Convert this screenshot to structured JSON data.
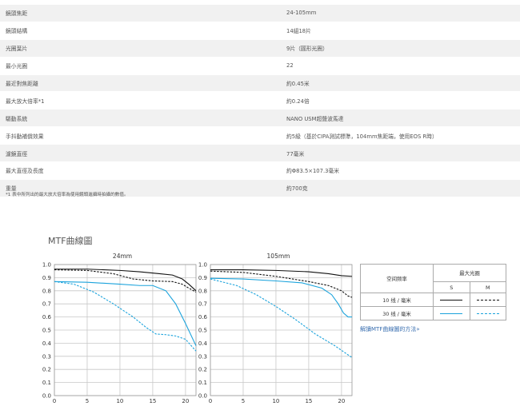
{
  "specs": [
    {
      "label": "鏡頭焦距",
      "value": "24-105mm"
    },
    {
      "label": "鏡頭結構",
      "value": "14組18片"
    },
    {
      "label": "光圈葉片",
      "value": "9片（圓形光圈）"
    },
    {
      "label": "最小光圈",
      "value": "22"
    },
    {
      "label": "最近對焦距離",
      "value": "約0.45米"
    },
    {
      "label": "最大放大倍率*1",
      "value": "約0.24倍"
    },
    {
      "label": "驅動系統",
      "value": "NANO USM超聲波馬達"
    },
    {
      "label": "手抖動補償效果",
      "value": "約5級（基於CIPA測試標準，104mm焦距端，使用EOS R時）"
    },
    {
      "label": "濾鏡直徑",
      "value": "77毫米"
    },
    {
      "label": "最大直徑及長度",
      "value": "約Φ83.5×107.3毫米"
    },
    {
      "label": "重量",
      "value": "約700克"
    }
  ],
  "footnote": "*1 表中所列出的最大放大倍率為使用鏡頭進攝時拍攝的數值。",
  "mtf_title": "MTF曲線圖",
  "legend": {
    "freq_header": "空间频率",
    "aperture_header": "最大光圈",
    "col_s": "S",
    "col_m": "M",
    "row_10": "10 线 / 毫米",
    "row_30": "30 线 / 毫米",
    "color_10": "#111111",
    "color_30": "#1ba3dc"
  },
  "link_text": "解讀MTF曲線圖的方法»",
  "chart_data": [
    {
      "type": "line",
      "title": "24mm",
      "xticks": [
        0,
        5,
        10,
        15,
        20
      ],
      "yticks": [
        0,
        0.1,
        0.2,
        0.3,
        0.4,
        0.5,
        0.6,
        0.7,
        0.8,
        0.9,
        1.0
      ],
      "xlim": [
        0,
        21.6
      ],
      "ylim": [
        0,
        1.0
      ],
      "grid": true,
      "series": [
        {
          "name": "10 线 / 毫米 S",
          "style": "solid",
          "color": "#111111",
          "x": [
            0,
            5,
            10,
            13,
            16,
            18,
            19.5,
            20.5,
            21.6
          ],
          "y": [
            0.965,
            0.965,
            0.955,
            0.945,
            0.93,
            0.92,
            0.89,
            0.85,
            0.8
          ]
        },
        {
          "name": "10 线 / 毫米 M",
          "style": "dashed",
          "color": "#111111",
          "x": [
            0,
            5,
            9,
            12,
            15,
            18,
            19.5,
            20.5,
            21.6
          ],
          "y": [
            0.96,
            0.955,
            0.93,
            0.89,
            0.875,
            0.87,
            0.85,
            0.82,
            0.79
          ]
        },
        {
          "name": "30 线 / 毫米 S",
          "style": "solid",
          "color": "#1ba3dc",
          "x": [
            0,
            5,
            10,
            13,
            15,
            17,
            18.5,
            20,
            21.6
          ],
          "y": [
            0.87,
            0.865,
            0.85,
            0.84,
            0.84,
            0.8,
            0.7,
            0.55,
            0.38
          ]
        },
        {
          "name": "30 线 / 毫米 M",
          "style": "dashed",
          "color": "#1ba3dc",
          "x": [
            0,
            3,
            6,
            9,
            12,
            14,
            15.5,
            17,
            18.5,
            20,
            21.6
          ],
          "y": [
            0.87,
            0.85,
            0.79,
            0.7,
            0.6,
            0.52,
            0.47,
            0.465,
            0.455,
            0.43,
            0.34
          ]
        }
      ]
    },
    {
      "type": "line",
      "title": "105mm",
      "xticks": [
        0,
        5,
        10,
        15,
        20
      ],
      "yticks": [
        0,
        0.1,
        0.2,
        0.3,
        0.4,
        0.5,
        0.6,
        0.7,
        0.8,
        0.9,
        1.0
      ],
      "xlim": [
        0,
        21.6
      ],
      "ylim": [
        0,
        1.0
      ],
      "grid": true,
      "series": [
        {
          "name": "10 线 / 毫米 S",
          "style": "solid",
          "color": "#111111",
          "x": [
            0,
            5,
            10,
            15,
            18,
            20,
            21.6
          ],
          "y": [
            0.96,
            0.96,
            0.955,
            0.945,
            0.93,
            0.915,
            0.91
          ]
        },
        {
          "name": "10 线 / 毫米 M",
          "style": "dashed",
          "color": "#111111",
          "x": [
            0,
            5,
            10,
            15,
            18,
            20,
            21,
            21.6
          ],
          "y": [
            0.95,
            0.94,
            0.91,
            0.87,
            0.84,
            0.8,
            0.76,
            0.75
          ]
        },
        {
          "name": "30 线 / 毫米 S",
          "style": "solid",
          "color": "#1ba3dc",
          "x": [
            0,
            5,
            10,
            14,
            17,
            18.5,
            19.5,
            20.3,
            21,
            21.6
          ],
          "y": [
            0.895,
            0.89,
            0.875,
            0.86,
            0.82,
            0.77,
            0.7,
            0.63,
            0.6,
            0.6
          ]
        },
        {
          "name": "30 线 / 毫米 M",
          "style": "dashed",
          "color": "#1ba3dc",
          "x": [
            0,
            4,
            7,
            10,
            13,
            16,
            19,
            21.6
          ],
          "y": [
            0.89,
            0.84,
            0.77,
            0.68,
            0.58,
            0.47,
            0.38,
            0.29
          ]
        }
      ]
    }
  ]
}
